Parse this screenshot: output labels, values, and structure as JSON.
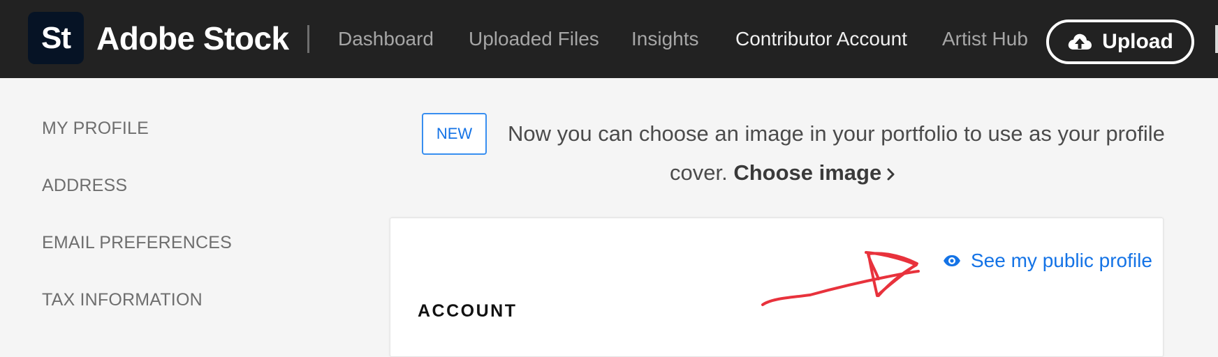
{
  "header": {
    "logo_text": "St",
    "brand": "Adobe Stock",
    "nav": [
      {
        "label": "Dashboard"
      },
      {
        "label": "Uploaded Files"
      },
      {
        "label": "Insights"
      },
      {
        "label": "Contributor Account"
      },
      {
        "label": "Artist Hub"
      }
    ],
    "upload_label": "Upload",
    "upload_icon": "cloud-upload-icon"
  },
  "sidebar": {
    "items": [
      {
        "label": "MY PROFILE"
      },
      {
        "label": "ADDRESS"
      },
      {
        "label": "EMAIL PREFERENCES"
      },
      {
        "label": "TAX INFORMATION"
      }
    ]
  },
  "announcement": {
    "badge": "NEW",
    "text_line1": "Now you can choose an image in your portfolio to use as your profile",
    "text_line2_prefix": "cover.",
    "link_label": "Choose image",
    "link_icon": "chevron-right-icon"
  },
  "card": {
    "public_profile_link": "See my public profile",
    "public_profile_icon": "eye-icon",
    "section_title": "ACCOUNT"
  },
  "colors": {
    "topbar_bg": "#222222",
    "page_bg": "#f5f5f5",
    "link_blue": "#1473e6",
    "annotation_red": "#e8323c"
  }
}
